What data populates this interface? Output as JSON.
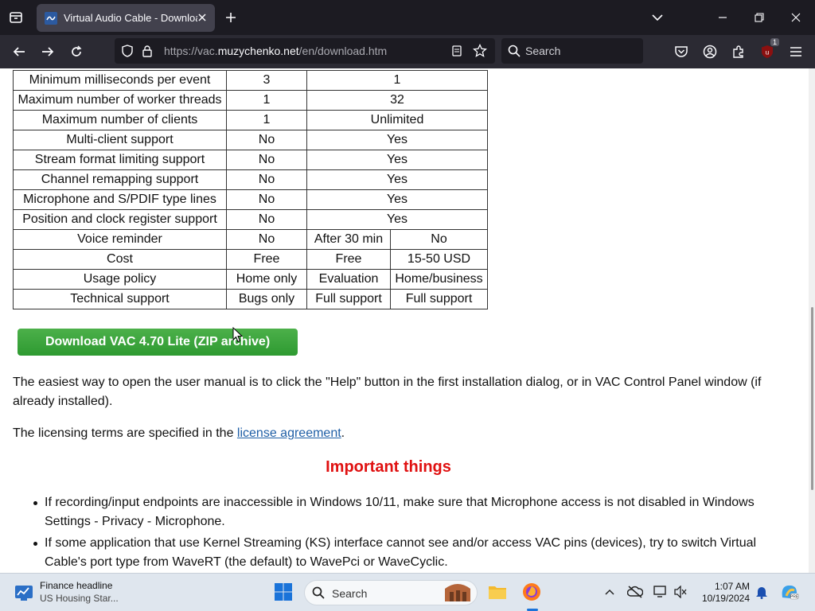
{
  "browser": {
    "tab_title": "Virtual Audio Cable - Download",
    "url_prefix": "https://vac.",
    "url_domain": "muzychenko.net",
    "url_path": "/en/download.htm",
    "search_placeholder": "Search",
    "extension_badge": "1"
  },
  "table": {
    "rows": [
      [
        "Minimum milliseconds per event",
        "3",
        "1"
      ],
      [
        "Maximum number of worker threads",
        "1",
        "32"
      ],
      [
        "Maximum number of clients",
        "1",
        "Unlimited"
      ],
      [
        "Multi-client support",
        "No",
        "Yes"
      ],
      [
        "Stream format limiting support",
        "No",
        "Yes"
      ],
      [
        "Channel remapping support",
        "No",
        "Yes"
      ],
      [
        "Microphone and S/PDIF type lines",
        "No",
        "Yes"
      ],
      [
        "Position and clock register support",
        "No",
        "Yes"
      ],
      [
        "Voice reminder",
        "No",
        "After 30 min",
        "No"
      ],
      [
        "Cost",
        "Free",
        "Free",
        "15-50 USD"
      ],
      [
        "Usage policy",
        "Home only",
        "Evaluation",
        "Home/business"
      ],
      [
        "Technical support",
        "Bugs only",
        "Full support",
        "Full support"
      ]
    ]
  },
  "download_button": "Download VAC 4.70 Lite (ZIP archive)",
  "manual_text": "The easiest way to open the user manual is to click the \"Help\" button in the first installation dialog, or in VAC Control Panel window (if already installed).",
  "license_text": "The licensing terms are specified in the ",
  "license_link": "license agreement",
  "license_end": ".",
  "important_heading": "Important things",
  "important_items": [
    "If recording/input endpoints are inaccessible in Windows 10/11, make sure that Microphone access is not disabled in Windows Settings - Privacy - Microphone.",
    "If some application that use Kernel Streaming (KS) interface cannot see and/or access VAC pins (devices), try to switch Virtual Cable's port type from WaveRT (the default) to WavePci or WaveCyclic."
  ],
  "taskbar": {
    "weather_title": "Finance headline",
    "weather_sub": "US Housing Star...",
    "search_placeholder": "Search",
    "time": "1:07 AM",
    "date": "10/19/2024"
  }
}
